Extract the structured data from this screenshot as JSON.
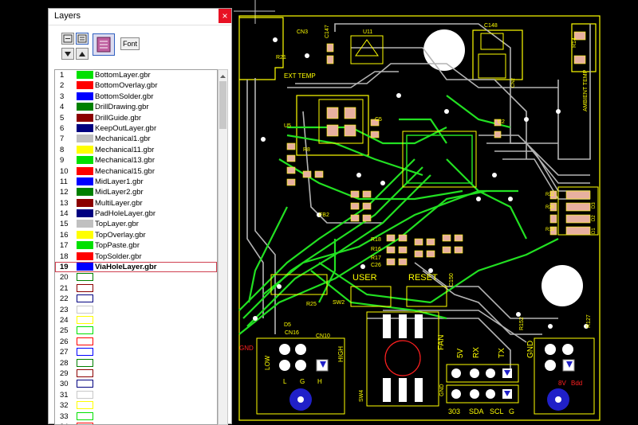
{
  "panel": {
    "title": "Layers",
    "close_glyph": "×",
    "font_label": "Font"
  },
  "toolbar_icons": [
    "hide-layers-icon",
    "show-layers-icon",
    "move-down-icon",
    "move-up-icon",
    "layer-color-icon"
  ],
  "layers": [
    {
      "num": "1",
      "name": "BottomLayer.gbr",
      "color": "#00e000"
    },
    {
      "num": "2",
      "name": "BottomOverlay.gbr",
      "color": "#ff0000"
    },
    {
      "num": "3",
      "name": "BottomSolder.gbr",
      "color": "#0000ff"
    },
    {
      "num": "4",
      "name": "DrillDrawing.gbr",
      "color": "#008000"
    },
    {
      "num": "5",
      "name": "DrillGuide.gbr",
      "color": "#8b0000"
    },
    {
      "num": "6",
      "name": "KeepOutLayer.gbr",
      "color": "#000080"
    },
    {
      "num": "7",
      "name": "Mechanical1.gbr",
      "color": "#c0c0c0"
    },
    {
      "num": "8",
      "name": "Mechanical11.gbr",
      "color": "#ffff00"
    },
    {
      "num": "9",
      "name": "Mechanical13.gbr",
      "color": "#00e000"
    },
    {
      "num": "10",
      "name": "Mechanical15.gbr",
      "color": "#ff0000"
    },
    {
      "num": "11",
      "name": "MidLayer1.gbr",
      "color": "#0000ff"
    },
    {
      "num": "12",
      "name": "MidLayer2.gbr",
      "color": "#008000"
    },
    {
      "num": "13",
      "name": "MultiLayer.gbr",
      "color": "#8b0000"
    },
    {
      "num": "14",
      "name": "PadHoleLayer.gbr",
      "color": "#000080"
    },
    {
      "num": "15",
      "name": "TopLayer.gbr",
      "color": "#c0c0c0"
    },
    {
      "num": "16",
      "name": "TopOverlay.gbr",
      "color": "#ffff00"
    },
    {
      "num": "17",
      "name": "TopPaste.gbr",
      "color": "#00e000"
    },
    {
      "num": "18",
      "name": "TopSolder.gbr",
      "color": "#ff0000"
    },
    {
      "num": "19",
      "name": "ViaHoleLayer.gbr",
      "color": "#0000ff",
      "selected": true
    },
    {
      "num": "20",
      "name": "",
      "color": "",
      "outline": "#008000"
    },
    {
      "num": "21",
      "name": "",
      "color": "",
      "outline": "#8b0000"
    },
    {
      "num": "22",
      "name": "",
      "color": "",
      "outline": "#000080"
    },
    {
      "num": "23",
      "name": "",
      "color": "",
      "outline": ""
    },
    {
      "num": "24",
      "name": "",
      "color": "",
      "outline": "#ffff00"
    },
    {
      "num": "25",
      "name": "",
      "color": "",
      "outline": "#00e000"
    },
    {
      "num": "26",
      "name": "",
      "color": "",
      "outline": "#ff0000"
    },
    {
      "num": "27",
      "name": "",
      "color": "",
      "outline": "#0000ff"
    },
    {
      "num": "28",
      "name": "",
      "color": "",
      "outline": "#008000"
    },
    {
      "num": "29",
      "name": "",
      "color": "",
      "outline": "#8b0000"
    },
    {
      "num": "30",
      "name": "",
      "color": "",
      "outline": "#000080"
    },
    {
      "num": "31",
      "name": "",
      "color": "",
      "outline": ""
    },
    {
      "num": "32",
      "name": "",
      "color": "",
      "outline": "#ffff00"
    },
    {
      "num": "33",
      "name": "",
      "color": "",
      "outline": "#00e000"
    },
    {
      "num": "34",
      "name": "",
      "color": "",
      "outline": "#ff0000"
    }
  ],
  "pcb_labels": {
    "cn3": "CN3",
    "u11": "U11",
    "c147": "C147",
    "c148": "C148",
    "r14": "R14",
    "r21": "R21",
    "ext_temp": "EXT TEMP",
    "ambient_temp": "AMBIENT TEMP",
    "cn2": "CN2",
    "c5": "C5",
    "c2": "C2",
    "u5": "U5",
    "r8": "R8",
    "fb2": "FB2",
    "r18": "R18",
    "r17": "R17",
    "c26": "C26",
    "r16": "R16",
    "user": "USER",
    "reset": "RESET",
    "sw2": "SW2",
    "sw4": "SW4",
    "c150": "C150",
    "r25": "R25",
    "d5": "D5",
    "cn16": "CN16",
    "cn10": "CN10",
    "low": "LOW",
    "high": "HIGH",
    "l": "L",
    "g": "G",
    "h": "H",
    "r152": "R152",
    "r127": "R127",
    "r20": "R20",
    "r19": "R19",
    "r22": "R22",
    "d3": "D3",
    "d2": "D2",
    "d1": "D1",
    "fan": "FAN",
    "gnd": "GND",
    "tx": "TX",
    "rx": "RX",
    "v5": "5V",
    "v303": "303",
    "sda": "SDA",
    "scl": "SCL",
    "g2": "G",
    "gnd2": "GND",
    "gnd3": "GND",
    "bp1": "8V",
    "bp2": "Bdd"
  },
  "colors": {
    "trace_green": "#22e022",
    "trace_gray": "#b4b4b4",
    "overlay_yellow": "#ffff00",
    "pad_red": "#dc3c3c",
    "via_blue": "#2020c8",
    "bottom_text": "#ff0000"
  }
}
